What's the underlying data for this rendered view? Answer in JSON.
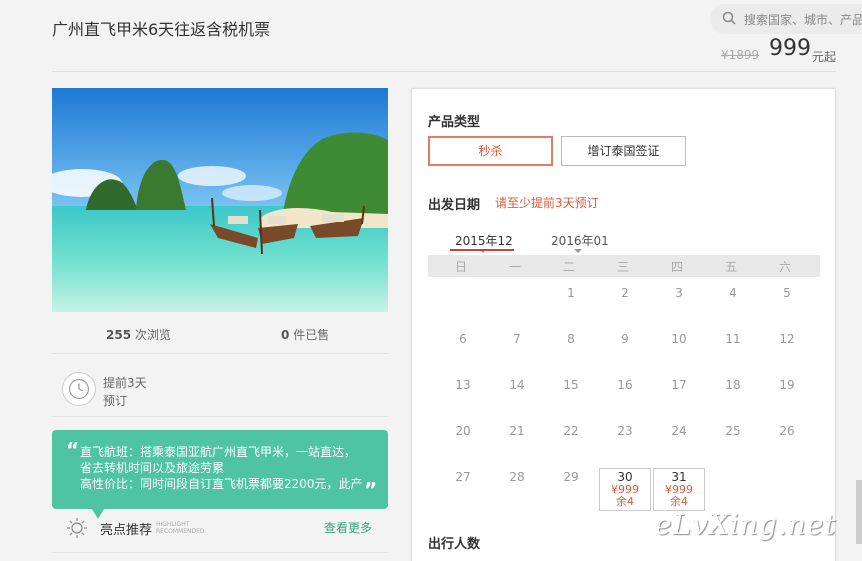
{
  "header": {
    "title": "广州直飞甲米6天往返含税机票",
    "search_placeholder": "搜索国家、城市、产品",
    "old_price": "¥1899",
    "price": "999",
    "price_unit": "元起"
  },
  "stats": {
    "views_count": "255",
    "views_label": "次浏览",
    "sold_count": "0",
    "sold_label": "件已售"
  },
  "advance": {
    "line1": "提前3天",
    "line2": "预订"
  },
  "highlight": {
    "open_quote": "“",
    "close_quote": "”",
    "line1": "直飞航班：搭乘泰国亚航广州直飞甲米，一站直达，",
    "line2": "省去转机时间以及旅途劳累",
    "line3": "高性价比：同时间段自订直飞机票都要2200元，此产"
  },
  "recommend": {
    "label": "亮点推荐",
    "en_line1": "HIGHLIGHT",
    "en_line2": "RECOMMENDED",
    "more": "查看更多"
  },
  "panel": {
    "product_type_label": "产品类型",
    "options": [
      {
        "label": "秒杀",
        "active": true
      },
      {
        "label": "增订泰国签证",
        "active": false
      }
    ],
    "date_label": "出发日期",
    "date_note": "请至少提前3天预订",
    "months": [
      "2015年12",
      "2016年01"
    ],
    "weekdays": [
      "日",
      "一",
      "二",
      "三",
      "四",
      "五",
      "六"
    ],
    "week_rows": [
      [
        "",
        "",
        "1",
        "2",
        "3",
        "4",
        "5"
      ],
      [
        "6",
        "7",
        "8",
        "9",
        "10",
        "11",
        "12"
      ],
      [
        "13",
        "14",
        "15",
        "16",
        "17",
        "18",
        "19"
      ],
      [
        "20",
        "21",
        "22",
        "23",
        "24",
        "25",
        "26"
      ],
      [
        "27",
        "28",
        "29"
      ]
    ],
    "available_days": [
      {
        "day": "30",
        "price": "¥999",
        "remain": "余4"
      },
      {
        "day": "31",
        "price": "¥999",
        "remain": "余4"
      }
    ],
    "travelers_label": "出行人数"
  },
  "watermark": "eLvXing.net",
  "colors": {
    "accent": "#e05a3a",
    "green": "#4fc4a1",
    "link": "#3aa381"
  }
}
